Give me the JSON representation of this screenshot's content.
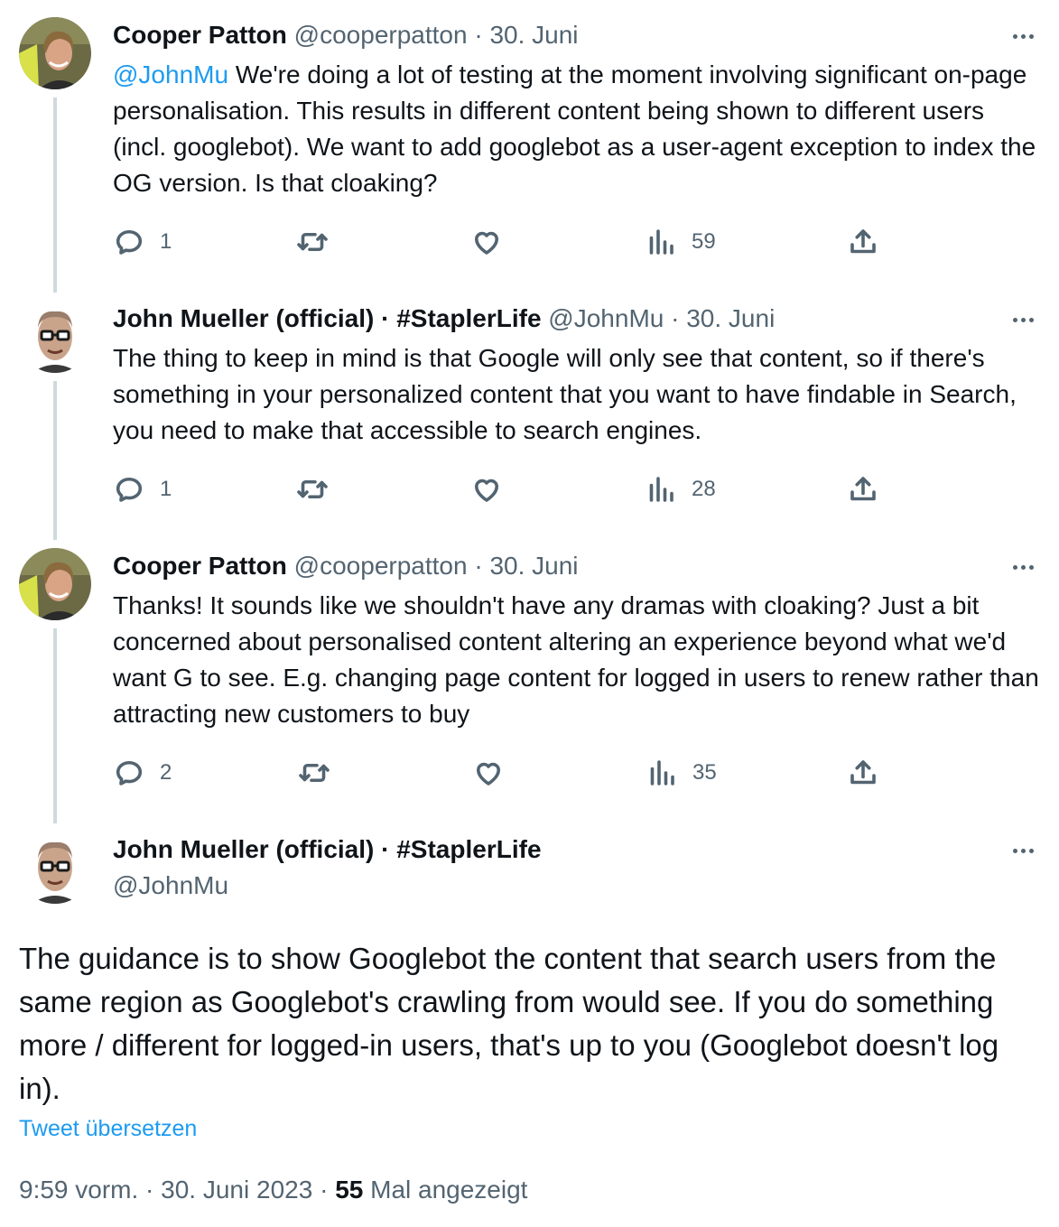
{
  "tweets": [
    {
      "name": "Cooper Patton",
      "handle": "@cooperpatton",
      "date": "· 30. Juni",
      "mention": "@JohnMu",
      "text": " We're doing a lot of testing at the moment involving significant on-page personalisation. This results in different content being shown to different users (incl. googlebot). We want to add googlebot as a user-agent exception to index the OG version. Is that cloaking?",
      "replies": "1",
      "views": "59"
    },
    {
      "name": "John Mueller (official) · #StaplerLife",
      "handle": "@JohnMu",
      "date": "· 30. Juni",
      "text": "The thing to keep in mind is that Google will only see that content, so if there's something in your personalized content that you want to have findable in Search, you need to make that accessible to search engines.",
      "replies": "1",
      "views": "28"
    },
    {
      "name": "Cooper Patton",
      "handle": "@cooperpatton",
      "date": "· 30. Juni",
      "text": "Thanks! It sounds like we shouldn't have any dramas with cloaking? Just a bit concerned about personalised content altering an experience beyond what we'd want G to see. E.g. changing page content for logged in users to renew rather than attracting new customers to buy",
      "replies": "2",
      "views": "35"
    }
  ],
  "main": {
    "name": "John Mueller (official) · #StaplerLife",
    "handle": "@JohnMu",
    "text": "The guidance is to show Googlebot the content that search users from the same region as Googlebot's crawling from would see. If you do something more / different for logged-in users, that's up to you (Googlebot doesn't log in).",
    "translate": "Tweet übersetzen",
    "time": "9:59 vorm. · 30. Juni 2023 · ",
    "views_count": "55",
    "views_label": " Mal angezeigt"
  },
  "colors": {
    "accent": "#1d9bf0",
    "secondary": "#536471",
    "thread_line": "#cfd9de"
  },
  "icons": [
    "reply-icon",
    "retweet-icon",
    "like-icon",
    "views-icon",
    "share-icon",
    "more-icon"
  ]
}
